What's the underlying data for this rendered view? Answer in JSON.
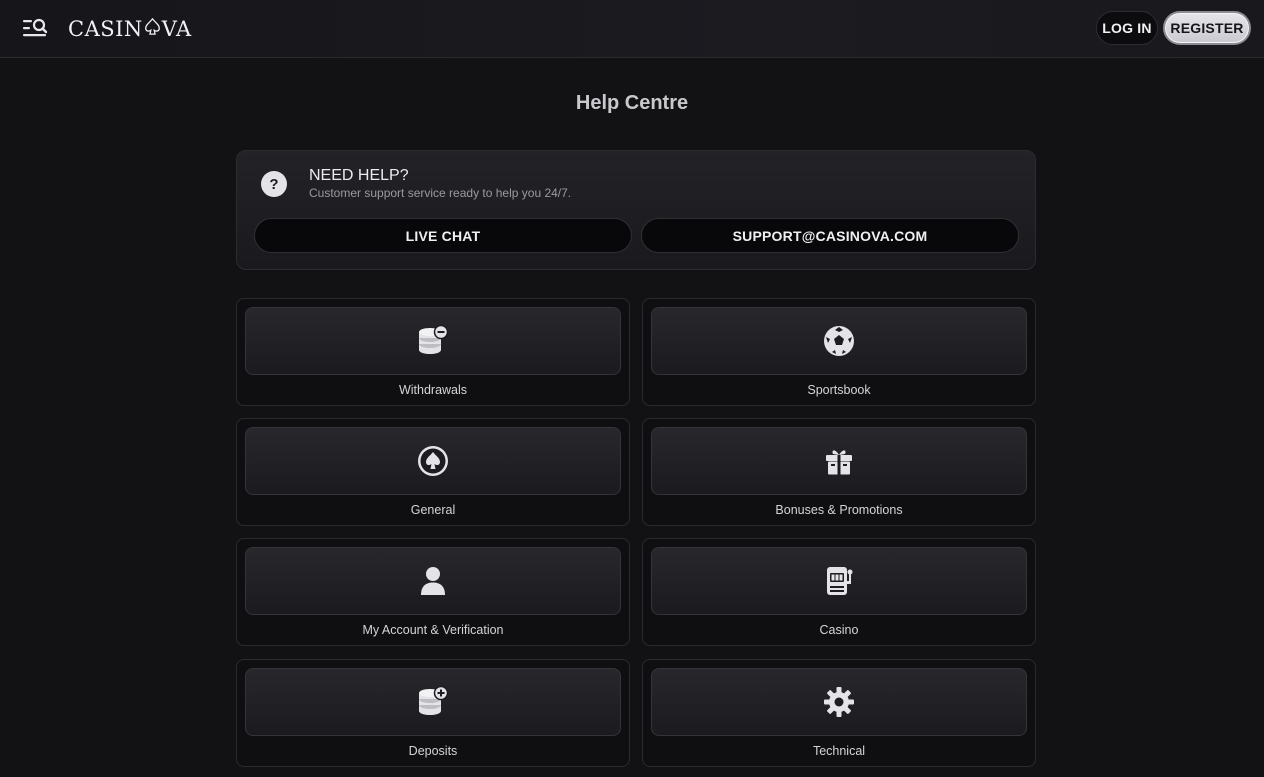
{
  "header": {
    "menu_icon": "menu-search-icon",
    "logo_left": "CASIN",
    "logo_mid_icon": "spade-icon",
    "logo_right": "VA",
    "login_label": "LOG IN",
    "register_label": "REGISTER"
  },
  "page": {
    "title": "Help Centre"
  },
  "help": {
    "icon": "question-icon",
    "title": "NEED HELP?",
    "subtitle": "Customer support service ready to help you 24/7.",
    "live_chat_label": "LIVE CHAT",
    "email_label": "SUPPORT@CASINOVA.COM"
  },
  "categories": [
    {
      "label": "Withdrawals",
      "icon": "coins-minus-icon"
    },
    {
      "label": "Sportsbook",
      "icon": "soccer-ball-icon"
    },
    {
      "label": "General",
      "icon": "spade-icon"
    },
    {
      "label": "Bonuses & Promotions",
      "icon": "gift-icon"
    },
    {
      "label": "My Account & Verification",
      "icon": "user-icon"
    },
    {
      "label": "Casino",
      "icon": "slot-machine-icon"
    },
    {
      "label": "Deposits",
      "icon": "coins-plus-icon"
    },
    {
      "label": "Technical",
      "icon": "gear-icon"
    }
  ],
  "colors": {
    "background": "#121215",
    "card": "#1f1f24",
    "icon": "#e4e4e8",
    "accent_light": "#d8d8dd"
  }
}
